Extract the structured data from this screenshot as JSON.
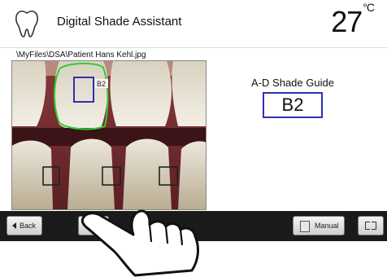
{
  "header": {
    "title": "Digital Shade Assistant",
    "temperature": "27",
    "temperature_unit": "°C",
    "icon": "tooth-icon"
  },
  "file_path": "\\MyFiles\\DSA\\Patient Hans Kehl.jpg",
  "photo": {
    "selected_shade_tag": "B2"
  },
  "shade_guide": {
    "label": "A-D Shade Guide",
    "value": "B2"
  },
  "toolbar": {
    "back_label": "Back",
    "camera_icon": "camera-icon",
    "manual_label": "Manual",
    "manual_icon": "book-icon",
    "fullscreen_icon": "fullscreen-icon"
  },
  "colors": {
    "selection_box": "#3030b0",
    "tooth_outline": "#33cc33",
    "sample_box": "#222222",
    "toolbar_bg": "#1a1a1a"
  }
}
